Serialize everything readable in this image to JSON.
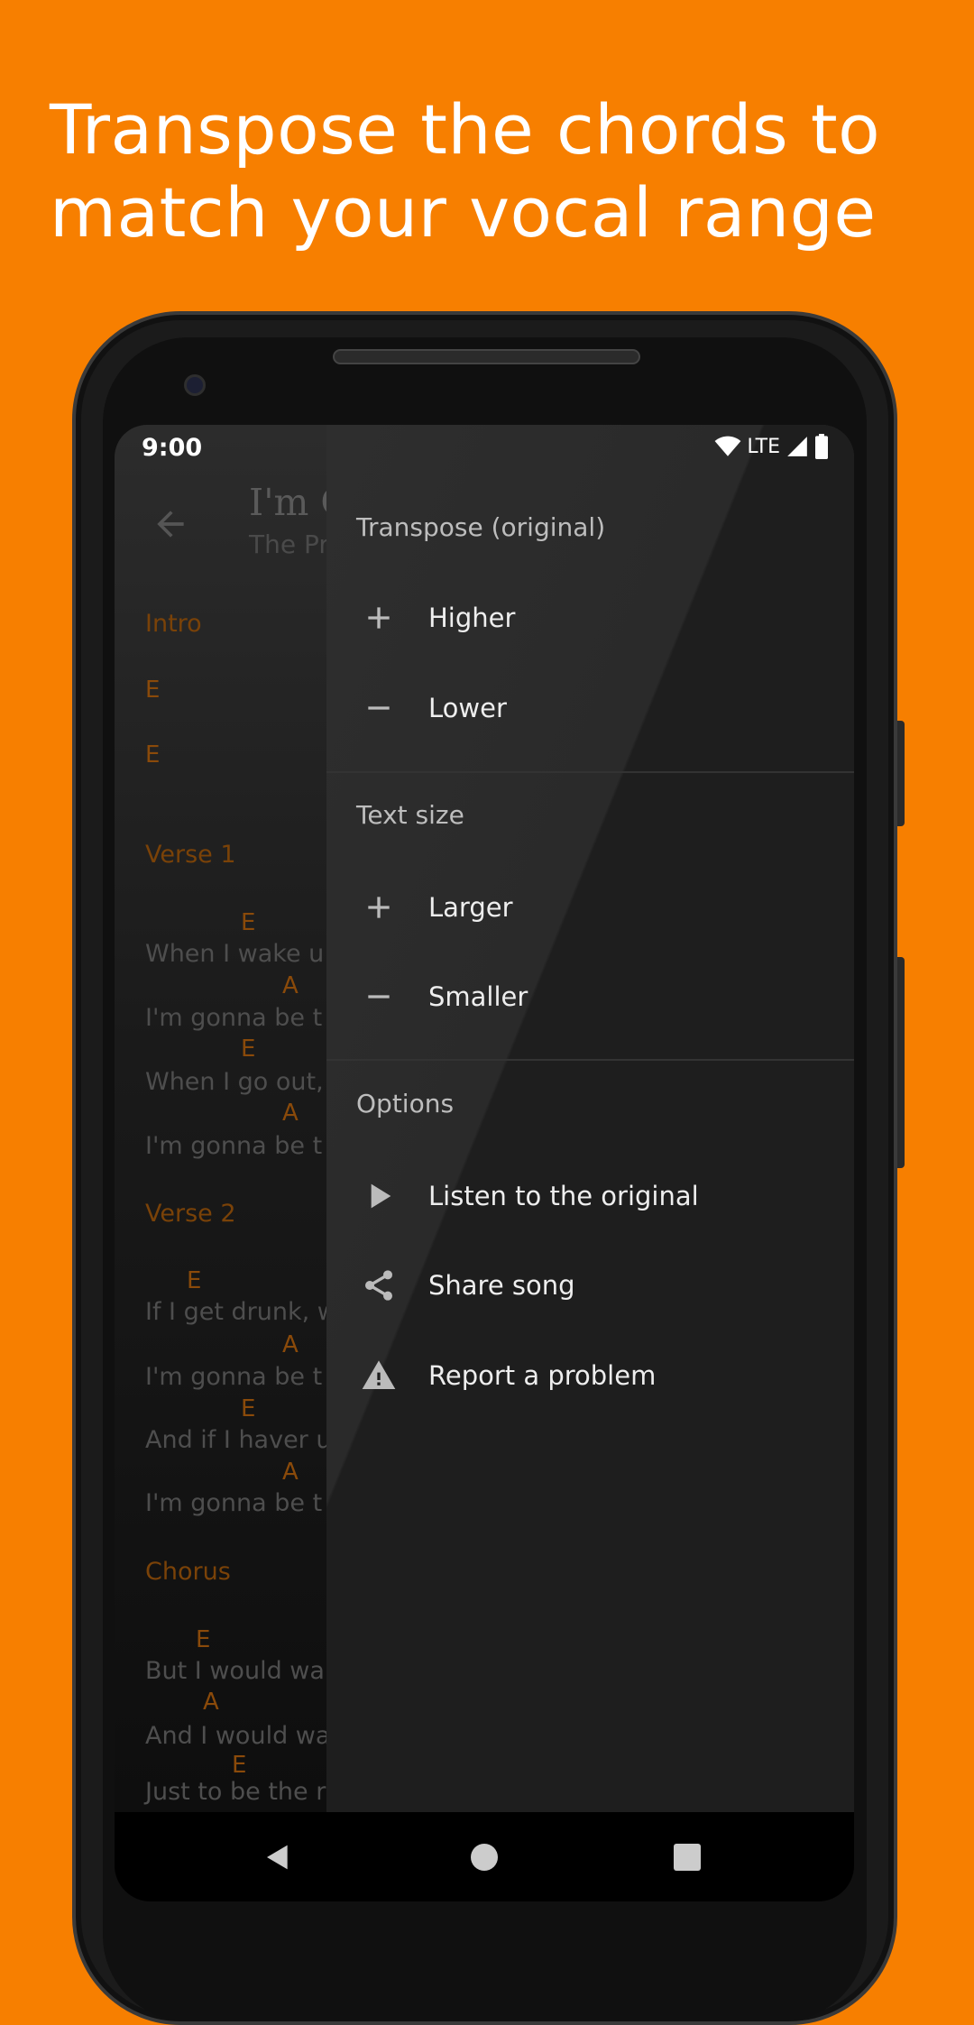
{
  "headline": [
    "Transpose the chords to",
    "match your vocal range"
  ],
  "colors": {
    "background": "#F77F00",
    "chord": "#8a4a0a",
    "menu": "#1e1e1e"
  },
  "status": {
    "time": "9:00",
    "network": "LTE",
    "icons": [
      "wifi-icon",
      "signal-icon",
      "battery-icon"
    ]
  },
  "song": {
    "title": "I'm G",
    "artist": "The Pr"
  },
  "lyrics": {
    "sections": [
      "Intro",
      "Verse 1",
      "Verse 2",
      "Chorus"
    ],
    "intro_chords": [
      "E",
      "E"
    ],
    "lines": [
      "When I wake u",
      "I'm gonna be t",
      "When I go out,",
      "I'm gonna be t",
      "If I get drunk, w",
      "I'm gonna be t",
      "And if I haver u",
      "I'm gonna be t",
      "But I would wa",
      "And I would wa",
      "Just to be the r"
    ],
    "chords": [
      "E",
      "A",
      "E",
      "A",
      "E",
      "A",
      "E",
      "A",
      "E",
      "A",
      "E"
    ]
  },
  "menu": {
    "transpose_header": "Transpose (original)",
    "higher": "Higher",
    "lower": "Lower",
    "text_size_header": "Text size",
    "larger": "Larger",
    "smaller": "Smaller",
    "options_header": "Options",
    "listen": "Listen to the original",
    "share": "Share song",
    "report": "Report a problem"
  }
}
